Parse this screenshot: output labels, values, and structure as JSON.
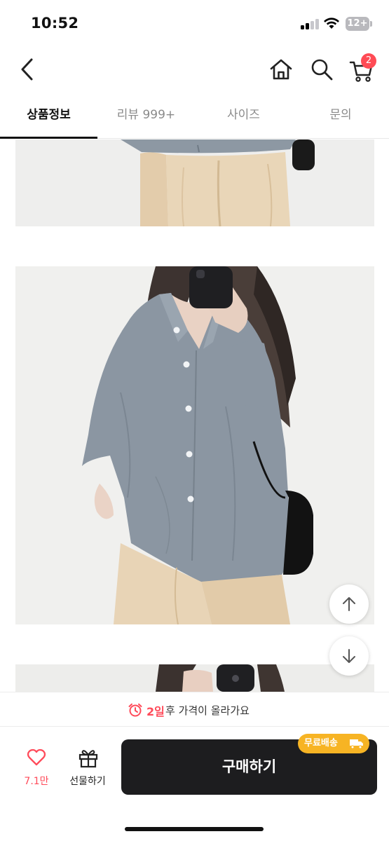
{
  "status_bar": {
    "time": "10:52",
    "battery": "12+"
  },
  "nav": {
    "icons": [
      "back-icon",
      "home-icon",
      "search-icon",
      "cart-icon"
    ],
    "cart_badge": "2"
  },
  "tabs": [
    {
      "label": "상품정보",
      "active": true
    },
    {
      "label": "리뷰 999+",
      "active": false
    },
    {
      "label": "사이즈",
      "active": false
    },
    {
      "label": "문의",
      "active": false
    }
  ],
  "content": {
    "images": [
      "product-photo-pants",
      "product-photo-shirt",
      "product-photo-mirror-selfie"
    ],
    "scroll_buttons": [
      "arrow-up-icon",
      "arrow-down-icon"
    ]
  },
  "notice": {
    "highlight": "2일",
    "text": "후 가격이 올라가요"
  },
  "actions": {
    "like_count": "7.1만",
    "gift_label": "선물하기",
    "buy_label": "구매하기",
    "free_shipping": "무료배송"
  },
  "colors": {
    "accent": "#ff4b5a",
    "buy_button": "#1d1d1f",
    "free_shipping_badge": "#f7b424"
  }
}
